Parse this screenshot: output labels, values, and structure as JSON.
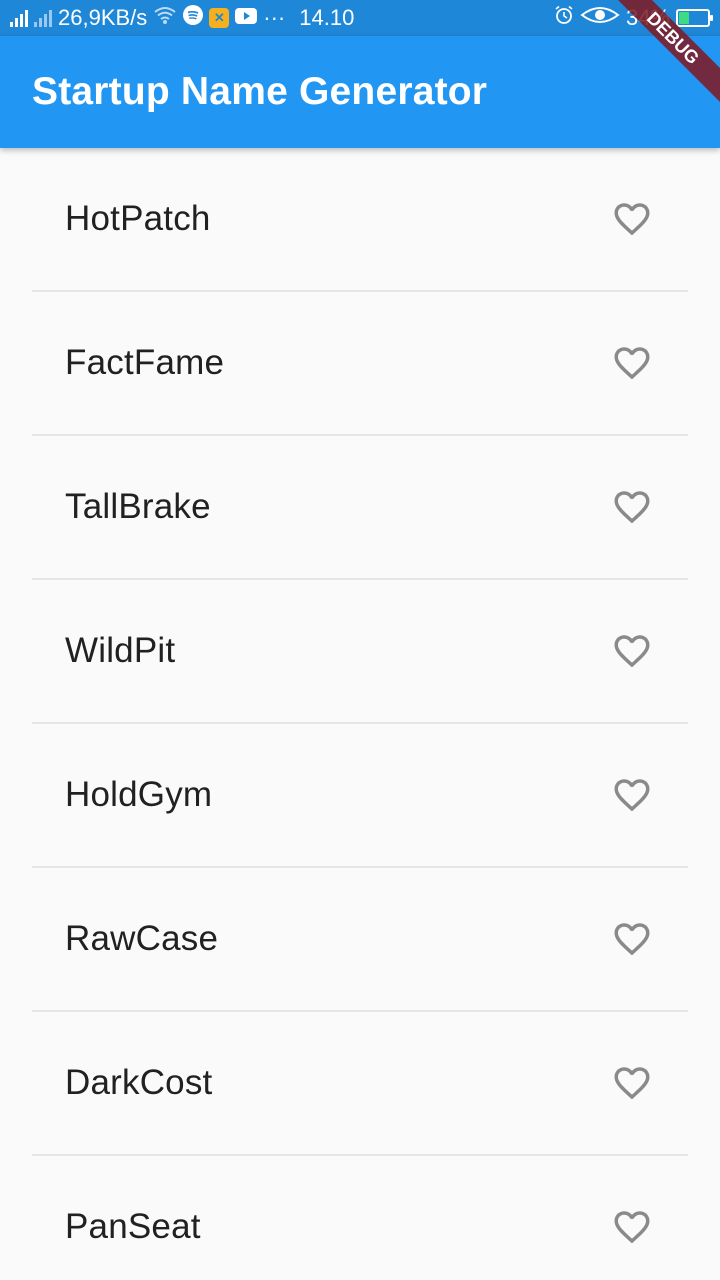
{
  "status_bar": {
    "network_speed": "26,9KB/s",
    "more_indicator": "···",
    "time": "14.10",
    "battery_percent": "34%",
    "battery_level": 0.34,
    "icons": [
      "signal-icon",
      "signal-icon",
      "wifi-icon",
      "spotify-icon",
      "app-icon",
      "youtube-icon",
      "alarm-icon",
      "eye-icon",
      "battery-icon"
    ]
  },
  "debug_banner": "DEBUG",
  "app_bar": {
    "title": "Startup Name Generator",
    "color": "#2196f3"
  },
  "list": {
    "items": [
      {
        "label": "HotPatch"
      },
      {
        "label": "FactFame"
      },
      {
        "label": "TallBrake"
      },
      {
        "label": "WildPit"
      },
      {
        "label": "HoldGym"
      },
      {
        "label": "RawCase"
      },
      {
        "label": "DarkCost"
      },
      {
        "label": "PanSeat"
      }
    ],
    "icon": "heart-outline-icon",
    "icon_color": "#8a8a8a"
  }
}
